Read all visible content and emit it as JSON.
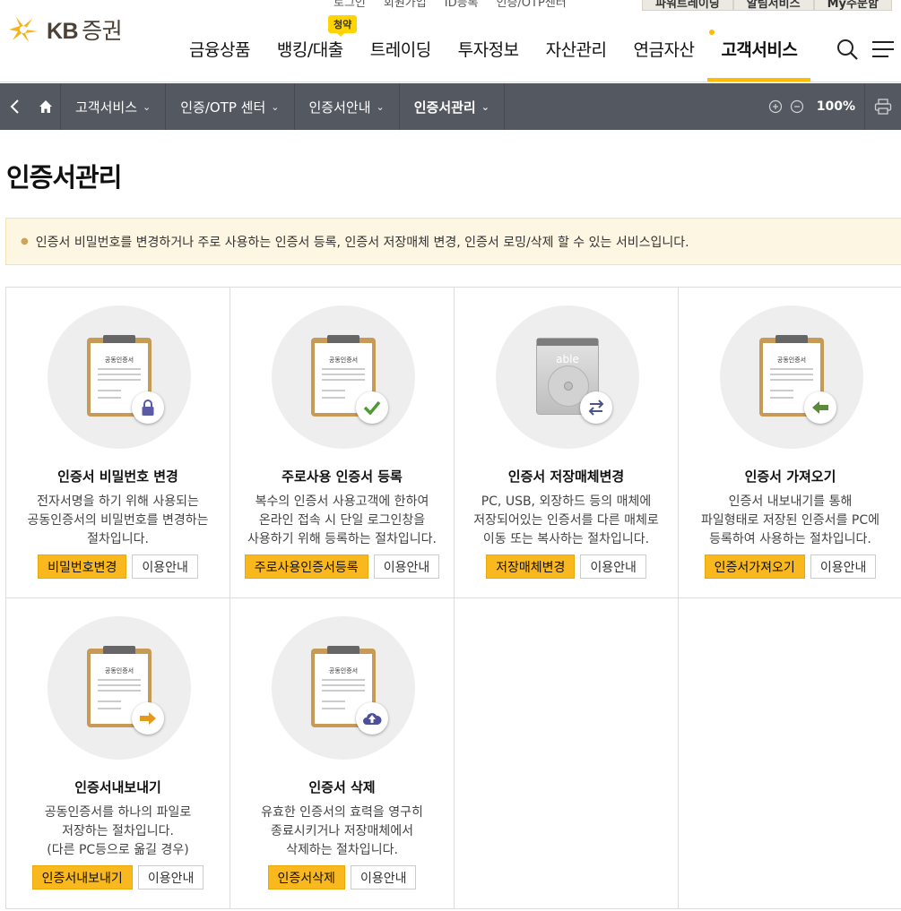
{
  "header": {
    "util_links": [
      "로그인",
      "회원가입",
      "ID등록",
      "인증/OTP센터"
    ],
    "util_tabs": [
      "파워트레이딩",
      "알림서비스",
      "My주문함"
    ],
    "logo": {
      "brand": "KB",
      "sub": "증권"
    },
    "gnb_badge": "청약",
    "gnb": [
      {
        "label": "금융상품"
      },
      {
        "label": "뱅킹/대출"
      },
      {
        "label": "트레이딩"
      },
      {
        "label": "투자정보"
      },
      {
        "label": "자산관리"
      },
      {
        "label": "연금자산"
      },
      {
        "label": "고객서비스",
        "active": true
      }
    ],
    "accent_color": "#ffbc00"
  },
  "breadcrumb": {
    "items": [
      {
        "label": "고객서비스"
      },
      {
        "label": "인증/OTP 센터"
      },
      {
        "label": "인증서안내"
      },
      {
        "label": "인증서관리",
        "current": true
      }
    ],
    "zoom": "100%"
  },
  "page": {
    "title": "인증서관리",
    "notice": "인증서 비밀번호를 변경하거나 주로 사용하는 인증서 등록, 인증서 저장매체 변경, 인증서 로밍/삭제 할 수 있는 서비스입니다."
  },
  "cards": [
    {
      "name": "인증서 비밀번호 변경",
      "icon": "lock-icon",
      "doc_title": "공동인증서",
      "desc": [
        "전자서명을 하기 위해 사용되는",
        "공동인증서의 비밀번호를 변경하는",
        "절차입니다."
      ],
      "primary": "비밀번호변경",
      "secondary": "이용안내"
    },
    {
      "name": "주로사용 인증서 등록",
      "icon": "check-icon",
      "doc_title": "공동인증서",
      "desc": [
        "복수의 인증서 사용고객에 한하여",
        "온라인 접속 시 단일 로그인창을",
        "사용하기 위해 등록하는 절차입니다."
      ],
      "primary": "주로사용인증서등록",
      "secondary": "이용안내"
    },
    {
      "name": "인증서 저장매체변경",
      "icon": "swap-arrows-icon",
      "disk_label": "able",
      "desc": [
        "PC, USB, 외장하드 등의 매체에",
        "저장되어있는 인증서를 다른 매체로",
        "이동 또는 복사하는 절차입니다."
      ],
      "primary": "저장매체변경",
      "secondary": "이용안내"
    },
    {
      "name": "인증서 가져오기",
      "icon": "arrow-left-icon",
      "doc_title": "공동인증서",
      "desc": [
        "인증서 내보내기를 통해",
        "파일형태로 저장된 인증서를 PC에",
        "등록하여 사용하는 절차입니다."
      ],
      "primary": "인증서가져오기",
      "secondary": "이용안내"
    },
    {
      "name": "인증서내보내기",
      "icon": "arrow-right-icon",
      "doc_title": "공동인증서",
      "desc": [
        "공동인증서를 하나의 파일로",
        "저장하는 절차입니다.",
        "(다른 PC등으로 옮길 경우)"
      ],
      "primary": "인증서내보내기",
      "secondary": "이용안내"
    },
    {
      "name": "인증서 삭제",
      "icon": "cloud-upload-icon",
      "doc_title": "공동인증서",
      "desc": [
        "유효한 인증서의 효력을 영구히",
        "종료시키거나 저장매체에서",
        "삭제하는 절차입니다."
      ],
      "primary": "인증서삭제",
      "secondary": "이용안내"
    }
  ]
}
